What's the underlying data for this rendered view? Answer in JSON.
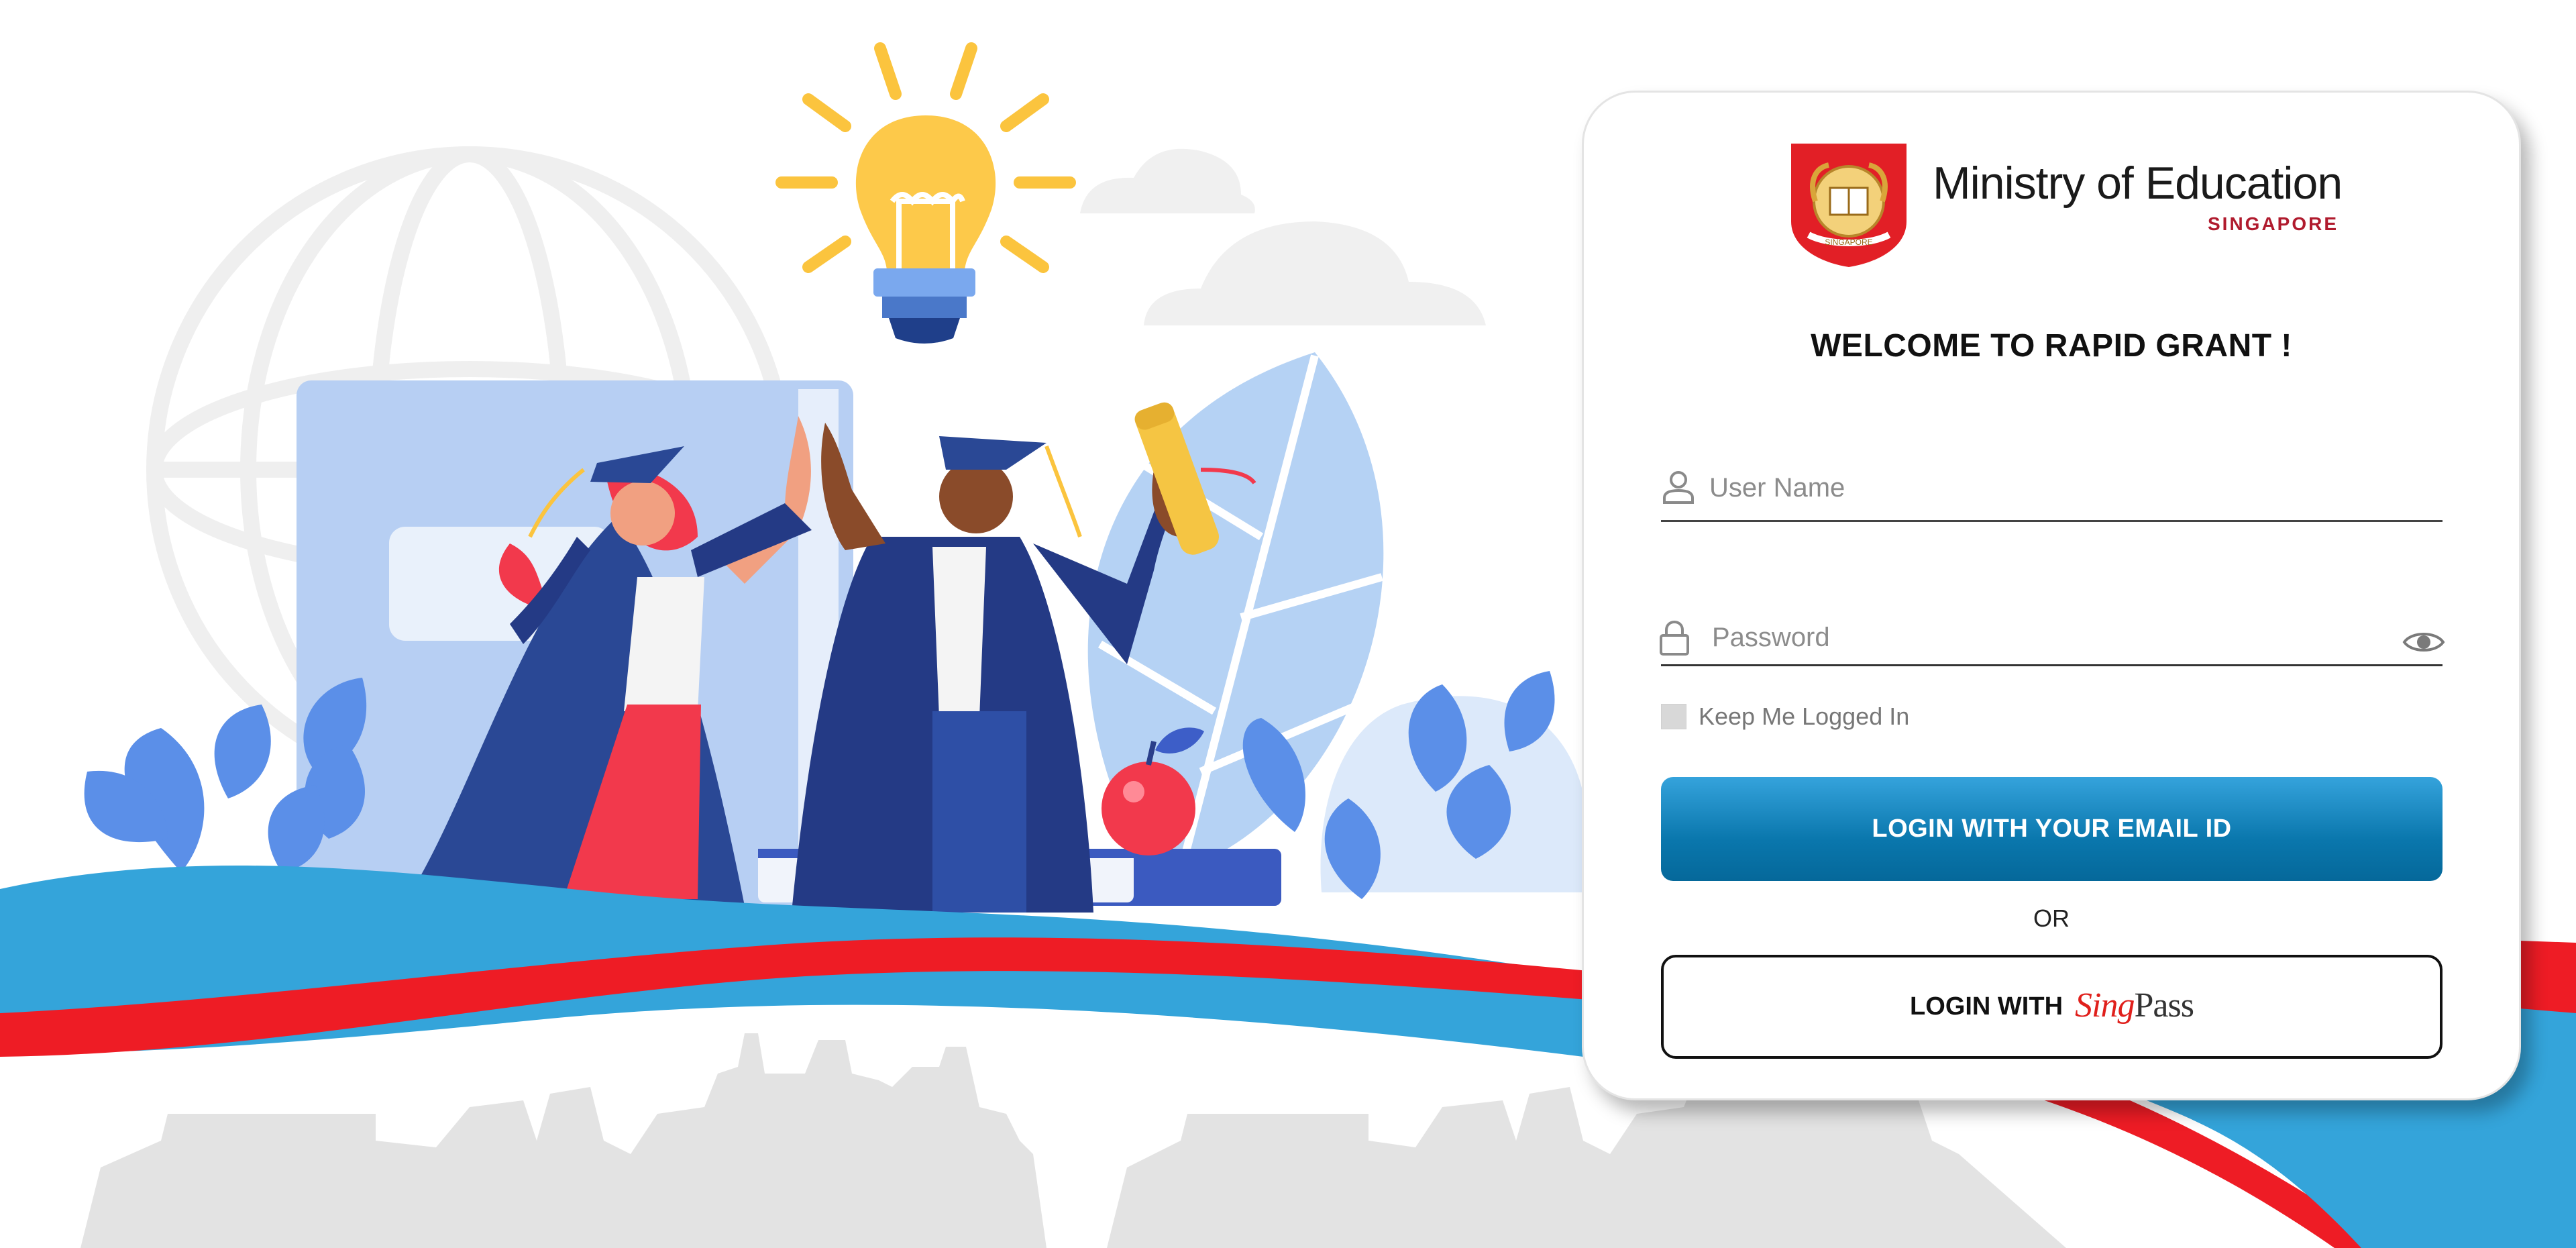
{
  "brand": {
    "name": "Ministry of Education",
    "country": "SINGAPORE",
    "crest_text": "SINGAPORE"
  },
  "login": {
    "welcome": "WELCOME TO RAPID GRANT !",
    "username_placeholder": "User Name",
    "password_placeholder": "Password",
    "keep_logged_in_label": "Keep Me Logged In",
    "email_button_label": "LOGIN WITH YOUR EMAIL ID",
    "or_label": "OR",
    "singpass_button_label": "LOGIN WITH",
    "singpass_logo": {
      "first": "Sing",
      "second": "Pass"
    }
  },
  "icons": {
    "user": "user-icon",
    "lock": "lock-icon",
    "eye": "eye-icon",
    "crest": "crest-icon"
  },
  "colors": {
    "primary_blue": "#0a77ad",
    "wave_blue": "#34a4da",
    "wave_red": "#ee1c25",
    "brand_red": "#b01b2e",
    "skyline_gray": "#e3e3e3"
  }
}
